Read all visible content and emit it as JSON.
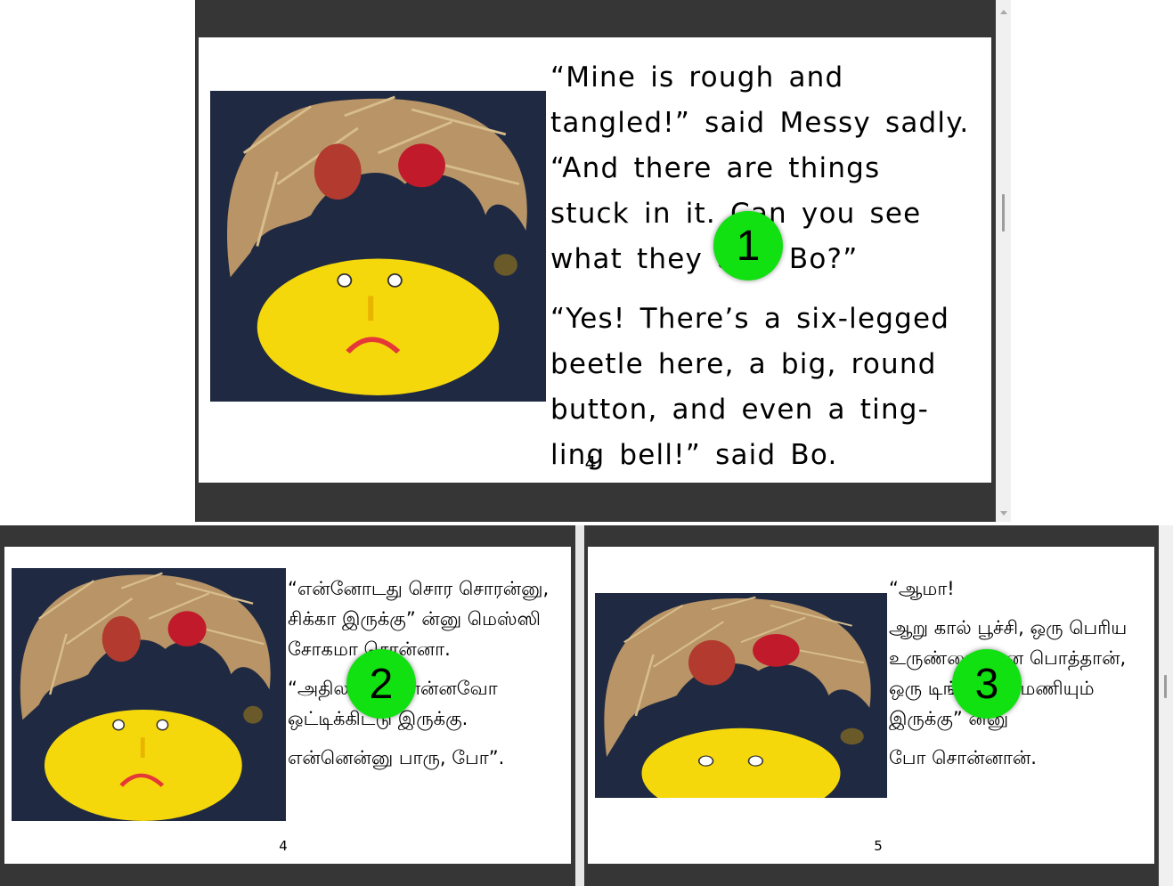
{
  "panel_top": {
    "page_number": "4",
    "paragraphs": [
      "“Mine is rough and tangled!” said Messy sadly. “And there are things stuck in it. Can you see what they are, Bo?”",
      "“Yes! There’s a six-legged beetle here, a big, round button, and even a ting-ling bell!” said Bo."
    ],
    "badge": "1",
    "image_icon": "messy-hair-face-illustration"
  },
  "panel_left": {
    "page_number": "4",
    "paragraphs": [
      "“என்னோடது சொர சொரன்னு, சிக்கா இருக்கு” ன்னு மெஸ்ஸி சோகமா சொன்னா.",
      "“அதில என்னென்னவோ ஒட்டிக்கிட்டு இருக்கு.",
      "என்னென்னு பாரு, போ”."
    ],
    "badge": "2",
    "image_icon": "messy-hair-face-illustration"
  },
  "panel_right": {
    "page_number": "5",
    "paragraphs": [
      "“ஆமா!",
      "ஆறு கால் பூச்சி, ஒரு பெரிய உருண்டையான பொத்தான், ஒரு டிங்க்டிங்க் மணியும் இருக்கு” ன்னு",
      "போ சொன்னான்."
    ],
    "badge": "3",
    "image_icon": "messy-hair-face-illustration"
  },
  "colors": {
    "viewer_bg": "#363636",
    "badge": "#11e011",
    "face": "#f5d80c",
    "hair": "#b89466",
    "cloth": "#1f2a42"
  }
}
